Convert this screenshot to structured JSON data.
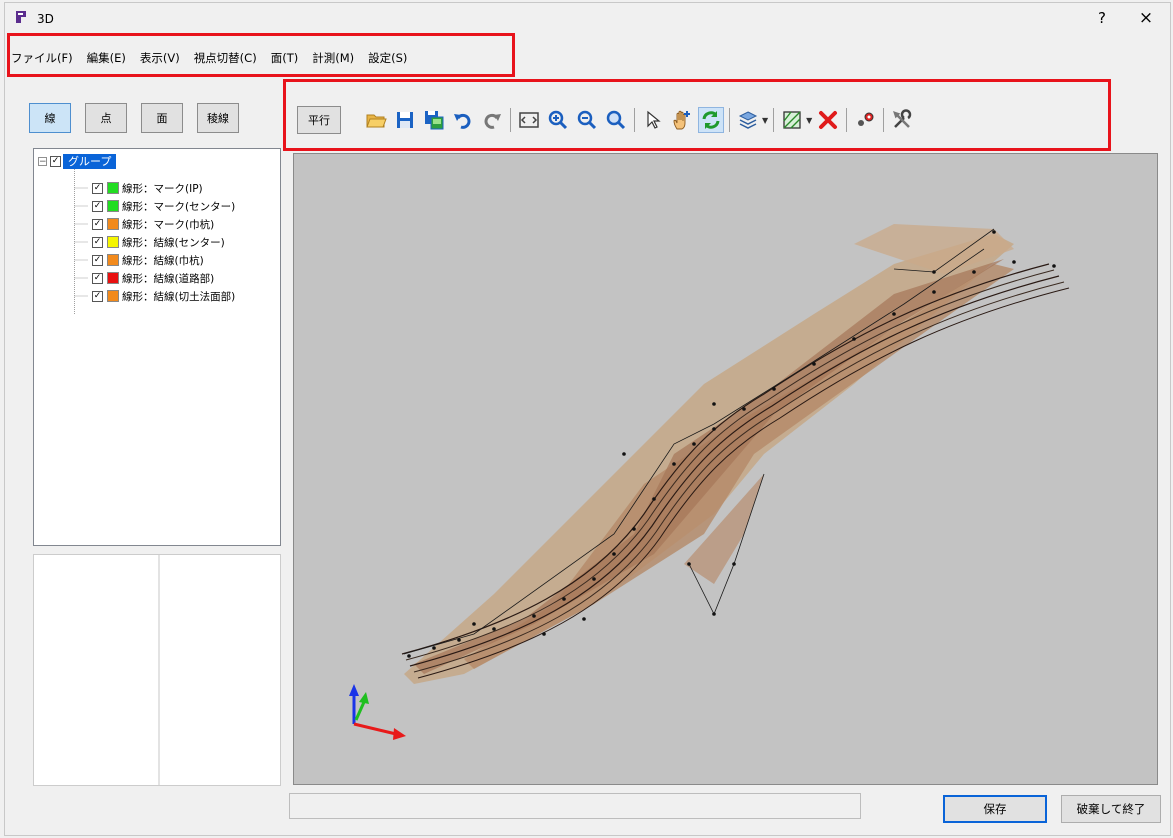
{
  "window": {
    "title": "3D",
    "help_label": "?",
    "close_label": "×"
  },
  "menu": [
    {
      "label": "ファイル(F)"
    },
    {
      "label": "編集(E)"
    },
    {
      "label": "表示(V)"
    },
    {
      "label": "視点切替(C)"
    },
    {
      "label": "面(T)"
    },
    {
      "label": "計測(M)"
    },
    {
      "label": "設定(S)"
    }
  ],
  "mode_buttons": [
    {
      "label": "線",
      "active": true
    },
    {
      "label": "点",
      "active": false
    },
    {
      "label": "面",
      "active": false
    },
    {
      "label": "稜線",
      "active": false
    }
  ],
  "toolbar": {
    "parallel_label": "平行",
    "icons": [
      "open-folder-icon",
      "save-icon",
      "save-image-icon",
      "undo-icon",
      "redo-icon",
      "fit-all-icon",
      "zoom-in-icon",
      "zoom-out-icon",
      "zoom-window-icon",
      "select-pointer-icon",
      "pan-hand-icon",
      "rotate-icon",
      "layers-icon",
      "surface-icon",
      "delete-icon",
      "points-icon",
      "tools-icon"
    ]
  },
  "tree": {
    "root_label": "グループ",
    "items": [
      {
        "label": "線形：マーク(IP)",
        "color": "#22dd22"
      },
      {
        "label": "線形：マーク(センター)",
        "color": "#22dd22"
      },
      {
        "label": "線形：マーク(巾杭)",
        "color": "#f28a1c"
      },
      {
        "label": "線形：結線(センター)",
        "color": "#f5f500"
      },
      {
        "label": "線形：結線(巾杭)",
        "color": "#f28a1c"
      },
      {
        "label": "線形：結線(道路部)",
        "color": "#e81010"
      },
      {
        "label": "線形：結線(切土法面部)",
        "color": "#f28a1c"
      }
    ]
  },
  "buttons": {
    "save": "保存",
    "discard_exit": "破棄して終了"
  },
  "colors": {
    "highlight": "#e8131b",
    "viewport_bg": "#c3c3c3",
    "selection": "#0a64d8"
  }
}
